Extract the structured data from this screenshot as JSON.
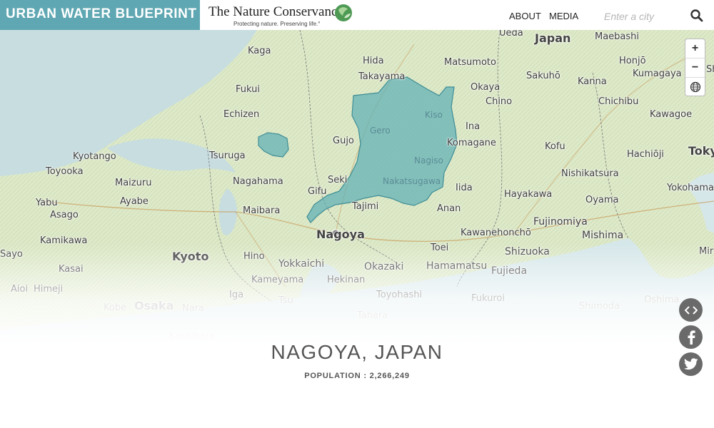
{
  "header": {
    "brand": "URBAN WATER BLUEPRINT",
    "tnc_name": "The Nature Conservancy",
    "tnc_tagline": "Protecting nature. Preserving life.°",
    "nav": [
      {
        "label": "ABOUT"
      },
      {
        "label": "MEDIA"
      }
    ],
    "search": {
      "placeholder": "Enter a city",
      "value": ""
    },
    "search_icon": "search-icon"
  },
  "map": {
    "labels": [
      "Ueda",
      "Japan",
      "Maebashi",
      "Kaga",
      "Hida",
      "Matsumoto",
      "Honjō",
      "Takayama",
      "Sakuhō",
      "Kumagaya",
      "Fukui",
      "Okaya",
      "Kanna",
      "Kiso",
      "Chino",
      "Chichibu",
      "Echizen",
      "Ina",
      "Kawagoe",
      "Gero",
      "Gujo",
      "Komagane",
      "Kofu",
      "Hachiōji",
      "Toky",
      "Kyotango",
      "Tsuruga",
      "Nagiso",
      "Toyooka",
      "Seki",
      "Nakatsugawa",
      "Nishikatsura",
      "Maizuru",
      "Nagahama",
      "Gifu",
      "Iida",
      "Yokohama",
      "Yabu",
      "Ayabe",
      "Tajimi",
      "Hayakawa",
      "Oyama",
      "Asago",
      "Maibara",
      "Anan",
      "Fujinomiya",
      "Nagoya",
      "Kawanehonchō",
      "Mishima",
      "Kamikawa",
      "Toei",
      "Shizuoka",
      "Kyoto",
      "Hino",
      "Yokkaichi",
      "Okazaki",
      "Hamamatsu",
      "Fujieda",
      "Kasai",
      "Kameyama",
      "Hekinan",
      "Aioi",
      "Himeji",
      "Iga",
      "Toyohashi",
      "Fukuroi",
      "Oshima",
      "Kobe",
      "Osaka",
      "Nara",
      "Tsu",
      "Shimoda",
      "Tahara",
      "Kashihara",
      "Mir",
      "Sayo",
      "Sh"
    ],
    "colors": {
      "watershed": "#5fb0b5",
      "brand": "#5fa7b2"
    }
  },
  "zoom": {
    "in": "+",
    "out": "−",
    "globe_icon": "globe-icon"
  },
  "city": {
    "name": "NAGOYA, JAPAN",
    "population": "POPULATION : 2,266,249"
  },
  "share": [
    "embed-code-icon",
    "facebook-icon",
    "twitter-icon"
  ]
}
